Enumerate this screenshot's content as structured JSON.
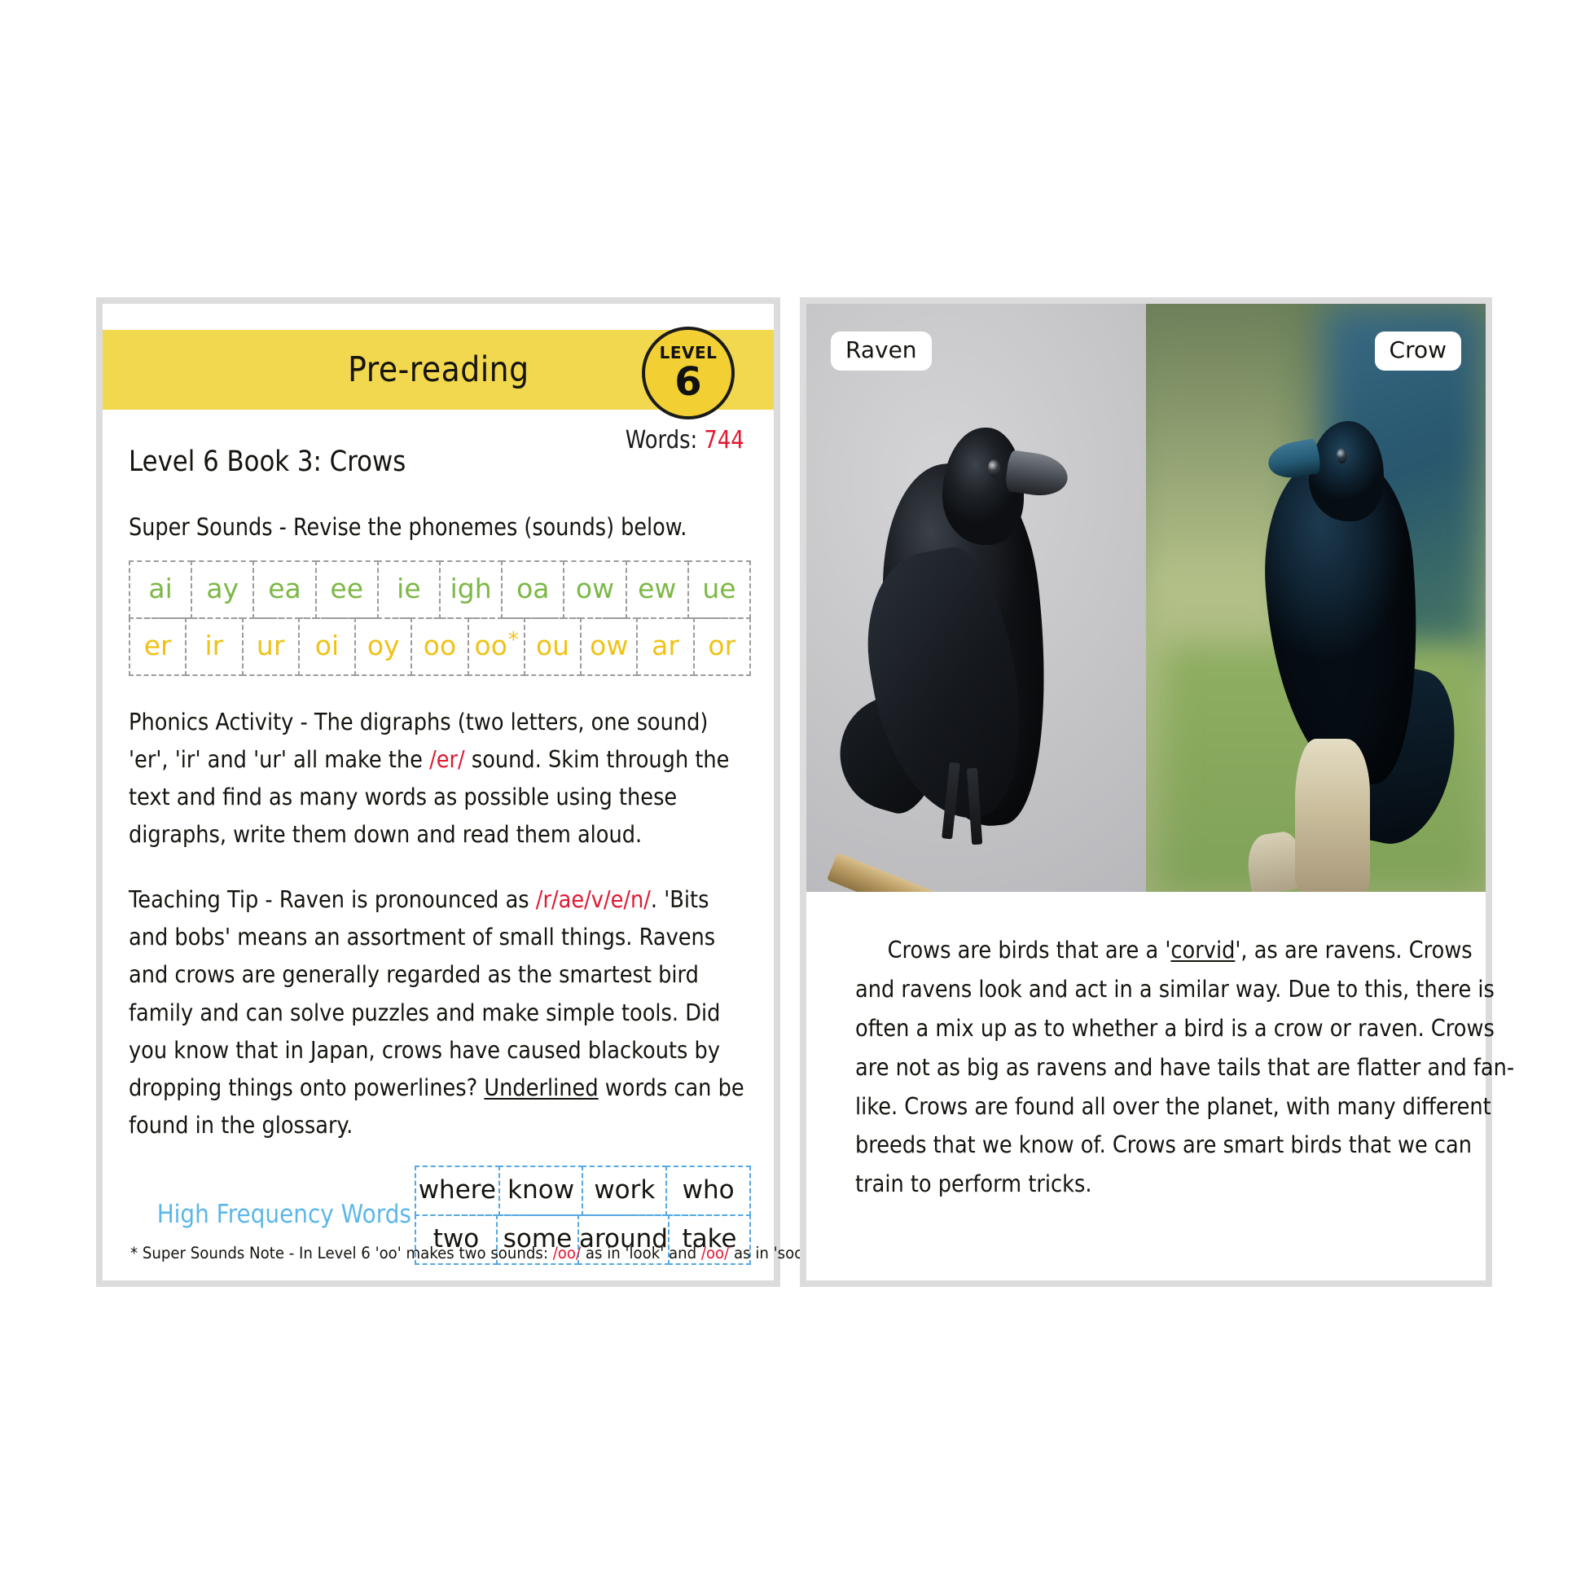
{
  "left_page": {
    "banner_title": "Pre-reading",
    "level_badge": {
      "word": "LEVEL",
      "number": "6"
    },
    "words_label": "Words:",
    "words_value": "744",
    "book_title": "Level 6 Book 3: Crows",
    "super_sounds_line": "Super Sounds - Revise the phonemes (sounds) below.",
    "phoneme_row_green": [
      "ai",
      "ay",
      "ea",
      "ee",
      "ie",
      "igh",
      "oa",
      "ow",
      "ew",
      "ue"
    ],
    "phoneme_row_yellow": [
      "er",
      "ir",
      "ur",
      "oi",
      "oy",
      "oo",
      "oo",
      "ou",
      "ow",
      "ar",
      "or"
    ],
    "phoneme_star_index": 6,
    "phonics_activity": {
      "prefix": "Phonics Activity - The digraphs (two letters, one sound) 'er', 'ir' and 'ur' all make the ",
      "highlight": "/er/",
      "suffix": " sound. Skim through the text and find as many words as possible using these digraphs, write them down and read them aloud."
    },
    "teaching_tip": {
      "part1": "Teaching Tip - Raven is pronounced as ",
      "highlight": "/r/ae/v/e/n/",
      "part2": ". 'Bits and bobs' means an assortment of small things. Ravens and crows are generally regarded as the smartest bird family and can solve puzzles and make simple tools. Did you know that in Japan, crows have caused blackouts by dropping things onto powerlines? ",
      "underlined": "Underlined",
      "part3": " words can be found in the glossary."
    },
    "hfw_label": "High Frequency Words",
    "hfw_rows": [
      [
        "where",
        "know",
        "work",
        "who"
      ],
      [
        "two",
        "some",
        "around",
        "take"
      ]
    ],
    "footnote": {
      "part1": "* Super Sounds Note - In Level 6 'oo' makes two sounds: ",
      "sound1": "/oo/",
      "part2": " as in 'look' and ",
      "sound2": "/oo/",
      "part3": " as in 'soon'."
    }
  },
  "right_page": {
    "photo_tags": {
      "left": "Raven",
      "right": "Crow"
    },
    "body_text": "Crows are birds that are a 'corvid', as are ravens. Crows and ravens look and act in a similar way. Due to this, there is often a mix up as to whether a bird is a crow or raven. Crows are not as big as ravens and have tails that are flatter and fan-like. Crows are found all over the planet, with many different breeds that we know of. Crows are smart birds that we can train to perform tricks.",
    "body_before_glossary": "Crows are birds that are a '",
    "body_glossary_word": "corvid",
    "body_after_glossary": "', as are ravens. Crows and ravens look and act in a similar way. Due to this, there is often a mix up as to whether a bird is a crow or raven. Crows are not as big as ravens and have tails that are flatter and fan-like. Crows are found all over the planet, with many different breeds that we know of. Crows are smart birds that we can train to perform tricks."
  },
  "colors": {
    "banner_yellow": "#f2d84e",
    "badge_yellow": "#f2d033",
    "accent_red": "#e01933",
    "green_phoneme": "#7cb846",
    "yellow_phoneme": "#f0c217",
    "blue_hfw": "#5bb7e8",
    "card_border": "#dcdcdc"
  }
}
